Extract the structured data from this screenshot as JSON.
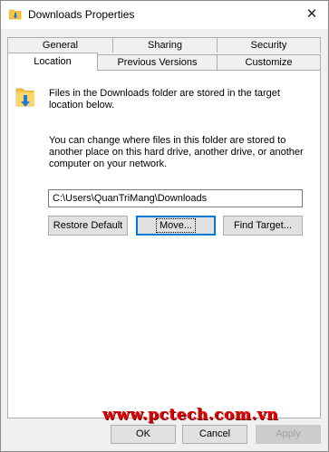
{
  "window": {
    "title": "Downloads Properties",
    "close_glyph": "✕",
    "icon": "folder-download-icon"
  },
  "tabs": {
    "row1": [
      {
        "label": "General"
      },
      {
        "label": "Sharing"
      },
      {
        "label": "Security"
      }
    ],
    "row2": [
      {
        "label": "Location",
        "selected": true
      },
      {
        "label": "Previous Versions"
      },
      {
        "label": "Customize"
      }
    ]
  },
  "location": {
    "description": "Files in the Downloads folder are stored in the target location below.",
    "instructions": "You can change where files in this folder are stored to another place on this hard drive, another drive, or another computer on your network.",
    "path": "C:\\Users\\QuanTriMang\\Downloads",
    "restore_default_label": "Restore Default",
    "move_label": "Move...",
    "find_target_label": "Find Target..."
  },
  "footer": {
    "ok_label": "OK",
    "cancel_label": "Cancel",
    "apply_label": "Apply"
  },
  "watermark": {
    "text": "www.pctech.com.vn"
  },
  "colors": {
    "focus_accent": "#0078d7",
    "folder_yellow": "#f6c343",
    "download_arrow": "#1f7ad6",
    "watermark_red": "#e00000"
  }
}
